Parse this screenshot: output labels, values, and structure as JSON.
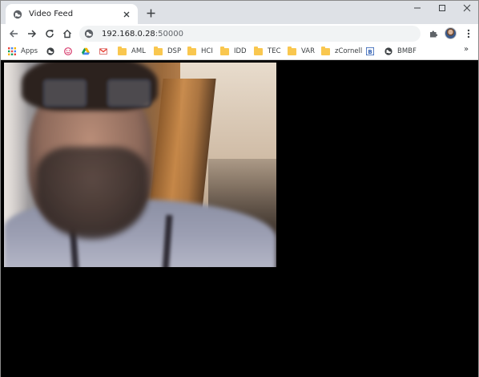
{
  "tab": {
    "title": "Video Feed",
    "favicon": "globe-icon",
    "close_icon": "close-icon"
  },
  "new_tab_icon": "plus-icon",
  "window_controls": [
    "minimize-icon",
    "maximize-icon",
    "close-icon"
  ],
  "toolbar": {
    "back_icon": "arrow-left-icon",
    "forward_icon": "arrow-right-icon",
    "reload_icon": "reload-icon",
    "home_icon": "home-icon",
    "extensions_icon": "puzzle-icon",
    "menu_icon": "kebab-menu-icon"
  },
  "omnibox": {
    "host": "192.168.0.28",
    "port": ":50000",
    "site_icon": "globe-icon"
  },
  "bookmarks": [
    {
      "label": "Apps",
      "icon": "apps-grid-icon"
    },
    {
      "label": "",
      "icon": "globe-icon"
    },
    {
      "label": "",
      "icon": "smiley-icon"
    },
    {
      "label": "",
      "icon": "drive-icon"
    },
    {
      "label": "",
      "icon": "gmail-icon"
    },
    {
      "label": "AML",
      "icon": "folder-icon"
    },
    {
      "label": "DSP",
      "icon": "folder-icon"
    },
    {
      "label": "HCI",
      "icon": "folder-icon"
    },
    {
      "label": "IDD",
      "icon": "folder-icon"
    },
    {
      "label": "TEC",
      "icon": "folder-icon"
    },
    {
      "label": "VAR",
      "icon": "folder-icon"
    },
    {
      "label": "zCornell",
      "icon": "folder-icon"
    },
    {
      "label": "",
      "icon": "bookmark-b-icon"
    },
    {
      "label": "BMBF",
      "icon": "globe-icon"
    }
  ],
  "bookmarks_overflow": "»",
  "colors": {
    "tabstrip": "#dee1e6",
    "omnibox": "#f1f3f4",
    "folder": "#f9c74f",
    "page_background": "#000000"
  }
}
